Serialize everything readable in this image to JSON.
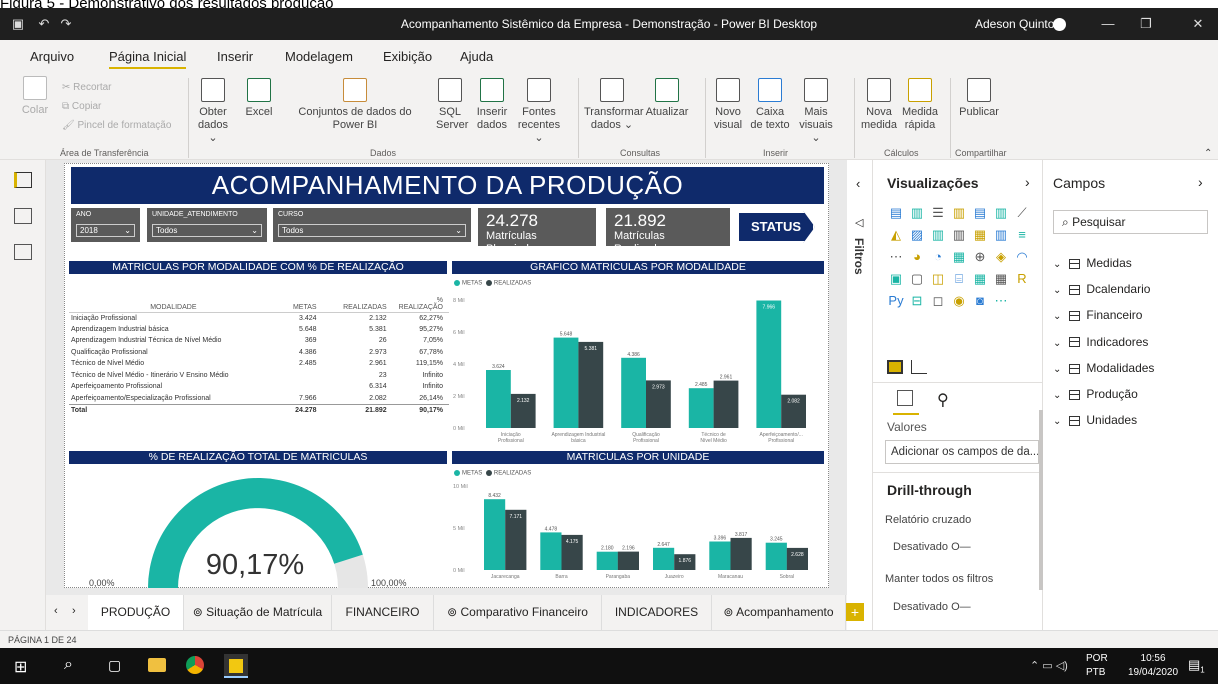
{
  "caption": "Figura 5 - Demonstrativo dos resultados produção",
  "window": {
    "title": "Acompanhamento Sistêmico da Empresa - Demonstração - Power BI Desktop",
    "user": "Adeson Quinto"
  },
  "ribbon_tabs": [
    "Arquivo",
    "Página Inicial",
    "Inserir",
    "Modelagem",
    "Exibição",
    "Ajuda"
  ],
  "ribbon": {
    "clipboard": {
      "paste": "Colar",
      "cut": "Recortar",
      "copy": "Copiar",
      "format": "Pincel de formatação",
      "group": "Área de Transferência"
    },
    "data": {
      "get": "Obter dados",
      "excel": "Excel",
      "datasets": "Conjuntos de dados do Power BI",
      "sql": "SQL Server",
      "enter": "Inserir dados",
      "recent": "Fontes recentes",
      "group": "Dados"
    },
    "queries": {
      "transform": "Transformar dados",
      "refresh": "Atualizar",
      "group": "Consultas"
    },
    "insert": {
      "newvisual": "Novo visual",
      "textbox": "Caixa de texto",
      "more": "Mais visuais",
      "group": "Inserir"
    },
    "calc": {
      "newmeasure": "Nova medida",
      "quickmeasure": "Medida rápida",
      "group": "Cálculos"
    },
    "share": {
      "publish": "Publicar",
      "group": "Compartilhar"
    }
  },
  "report": {
    "title": "ACOMPANHAMENTO DA PRODUÇÃO",
    "slicers": [
      {
        "label": "ANO",
        "value": "2018"
      },
      {
        "label": "UNIDADE_ATENDIMENTO",
        "value": "Todos"
      },
      {
        "label": "CURSO",
        "value": "Todos"
      }
    ],
    "kpis": [
      {
        "value": "24.278",
        "label": "Matrículas Planejadas"
      },
      {
        "value": "21.892",
        "label": "Matrículas Realizadas"
      }
    ],
    "status_button": "STATUS",
    "table": {
      "title": "MATRICULAS POR MODALIDADE COM % DE REALIZAÇÃO",
      "headers": [
        "MODALIDADE",
        "METAS",
        "REALIZADAS",
        "% REALIZAÇÃO"
      ],
      "rows": [
        [
          "Iniciação Profissional",
          "3.424",
          "2.132",
          "62,27%"
        ],
        [
          "Aprendizagem Industrial básica",
          "5.648",
          "5.381",
          "95,27%"
        ],
        [
          "Aprendizagem Industrial Técnica de Nível Médio",
          "369",
          "26",
          "7,05%"
        ],
        [
          "Qualificação Profissional",
          "4.386",
          "2.973",
          "67,78%"
        ],
        [
          "Técnico de Nível Médio",
          "2.485",
          "2.961",
          "119,15%"
        ],
        [
          "Técnico de Nível Médio - Itinerário V Ensino Médio",
          "",
          "23",
          "Infinito"
        ],
        [
          "Aperfeiçoamento Profissional",
          "",
          "6.314",
          "Infinito"
        ],
        [
          "Aperfeiçoamento/Especialização Profissional",
          "7.966",
          "2.082",
          "26,14%"
        ]
      ],
      "total": [
        "Total",
        "24.278",
        "21.892",
        "90,17%"
      ]
    },
    "gauge": {
      "title": "% DE REALIZAÇÃO TOTAL DE MATRICULAS",
      "value": "90,17%",
      "fraction": 0.9017,
      "min": "0,00%",
      "max": "100,00%"
    },
    "chart_data": [
      {
        "type": "bar",
        "title": "GRAFICO MATRICULAS POR MODALIDADE",
        "categories": [
          "Iniciação Profissional",
          "Aprendizagem Industrial básica",
          "Qualificação Profissional",
          "Técnico de Nível Médio",
          "Aperfeiçoamento/... Profissional"
        ],
        "series": [
          {
            "name": "METAS",
            "values": [
              3624,
              5648,
              4386,
              2485,
              7966
            ],
            "labels": [
              "3.624",
              "5.648",
              "4.386",
              "2.485",
              "7.966"
            ]
          },
          {
            "name": "REALIZADAS",
            "values": [
              2132,
              5381,
              2973,
              2961,
              2082
            ],
            "labels": [
              "2.132",
              "5.381",
              "2.973",
              "2.961",
              "2.082"
            ]
          }
        ],
        "yticks": [
          "0 Mil",
          "2 Mil",
          "4 Mil",
          "6 Mil",
          "8 Mil"
        ],
        "ylim": [
          0,
          8000
        ],
        "colors": [
          "#1ab5a5",
          "#374649"
        ]
      },
      {
        "type": "bar",
        "title": "MATRICULAS POR UNIDADE",
        "categories": [
          "Jacarecanga",
          "Barra",
          "Parangaba",
          "Juazeiro",
          "Maracanau",
          "Sobral"
        ],
        "series": [
          {
            "name": "METAS",
            "values": [
              8432,
              4478,
              2180,
              2647,
              3396,
              3245
            ],
            "labels": [
              "8.432",
              "4.478",
              "2.180",
              "2.647",
              "3.396",
              "3.245"
            ]
          },
          {
            "name": "REALIZADAS",
            "values": [
              7171,
              4175,
              2196,
              1876,
              3817,
              2628
            ],
            "labels": [
              "7.171",
              "4.175",
              "2.196",
              "1.876",
              "3.817",
              "2.628"
            ]
          }
        ],
        "yticks": [
          "0 Mil",
          "5 Mil",
          "10 Mil"
        ],
        "ylim": [
          0,
          10000
        ],
        "colors": [
          "#1ab5a5",
          "#374649"
        ]
      }
    ]
  },
  "viz_panel": {
    "title": "Visualizações",
    "filters": "Filtros",
    "values": "Valores",
    "add_fields": "Adicionar os campos de da...",
    "drill": "Drill-through",
    "cross": "Relatório cruzado",
    "off1": "Desativado",
    "keep": "Manter todos os filtros",
    "off2": "Desativado",
    "more": "..."
  },
  "fields_panel": {
    "title": "Campos",
    "search": "Pesquisar",
    "tables": [
      "Medidas",
      "Dcalendario",
      "Financeiro",
      "Indicadores",
      "Modalidades",
      "Produção",
      "Unidades"
    ]
  },
  "page_tabs": [
    "PRODUÇÃO",
    "Situação de Matrícula",
    "FINANCEIRO",
    "Comparativo Financeiro",
    "INDICADORES",
    "Acompanhamento"
  ],
  "status_bar": "PÁGINA 1 DE 24",
  "taskbar": {
    "lang": "POR",
    "layout": "PTB",
    "time": "10:56",
    "date": "19/04/2020",
    "notif": "1"
  }
}
